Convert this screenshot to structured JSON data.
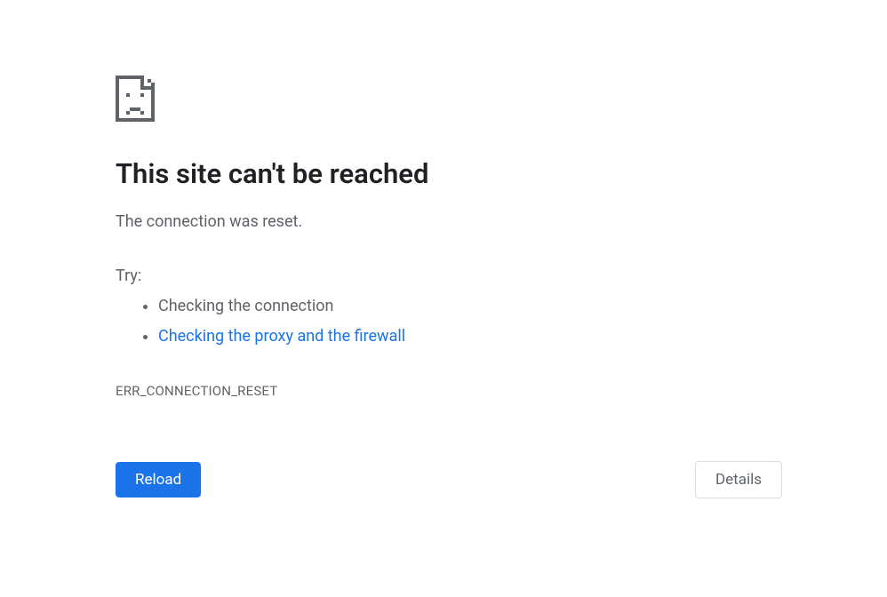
{
  "error": {
    "heading": "This site can't be reached",
    "message": "The connection was reset.",
    "try_label": "Try:",
    "suggestions": {
      "check_connection": "Checking the connection",
      "check_proxy_firewall": "Checking the proxy and the firewall"
    },
    "error_code": "ERR_CONNECTION_RESET"
  },
  "buttons": {
    "reload": "Reload",
    "details": "Details"
  }
}
